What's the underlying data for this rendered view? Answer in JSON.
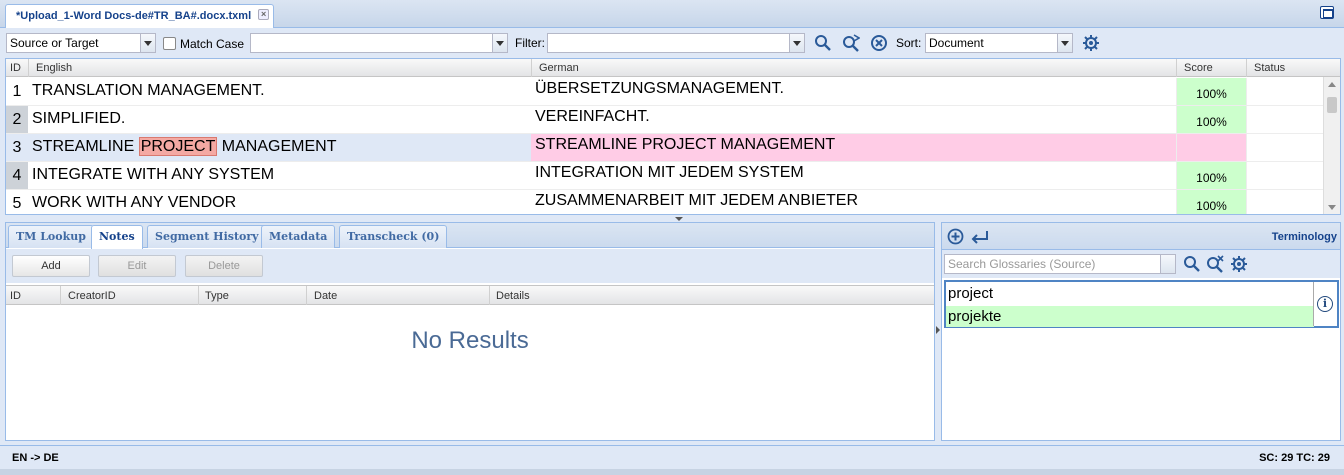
{
  "document_tab": {
    "title": "*Upload_1-Word Docs-de#TR_BA#.docx.txml",
    "close": "×"
  },
  "toolbar": {
    "scope_select": "Source or Target",
    "match_case_label": "Match Case",
    "search_value": "",
    "filter_label": "Filter:",
    "filter_value": "",
    "sort_label": "Sort:",
    "sort_value": "Document"
  },
  "grid": {
    "columns": {
      "id": "ID",
      "source": "English",
      "target": "German",
      "score": "Score",
      "status": "Status"
    },
    "rows": [
      {
        "id": "1",
        "source": "TRANSLATION MANAGEMENT.",
        "target": "ÜBERSETZUNGSMANAGEMENT.",
        "score": "100%",
        "status": ""
      },
      {
        "id": "2",
        "source": "SIMPLIFIED.",
        "target": "VEREINFACHT.",
        "score": "100%",
        "status": ""
      },
      {
        "id": "3",
        "source_pre": "STREAMLINE ",
        "source_hl": "PROJECT",
        "source_post": " MANAGEMENT",
        "target": "STREAMLINE PROJECT MANAGEMENT",
        "score": "",
        "status": ""
      },
      {
        "id": "4",
        "source": "INTEGRATE WITH ANY SYSTEM",
        "target": "INTEGRATION MIT JEDEM SYSTEM",
        "score": "100%",
        "status": ""
      },
      {
        "id": "5",
        "source": "WORK WITH ANY VENDOR",
        "target": "ZUSAMMENARBEIT MIT JEDEM ANBIETER",
        "score": "100%",
        "status": ""
      }
    ]
  },
  "bottom_tabs": [
    "TM Lookup",
    "Notes",
    "Segment History",
    "Metadata",
    "Transcheck (0)"
  ],
  "notes": {
    "buttons": {
      "add": "Add",
      "edit": "Edit",
      "delete": "Delete"
    },
    "columns": {
      "id": "ID",
      "creator": "CreatorID",
      "type": "Type",
      "date": "Date",
      "details": "Details"
    },
    "empty_text": "No Results"
  },
  "terminology": {
    "title": "Terminology",
    "search_placeholder": "Search Glossaries (Source)",
    "source_term": "project",
    "target_term": "projekte",
    "info_glyph": "i"
  },
  "status_bar": {
    "language_pair": "EN -> DE",
    "counts": "SC: 29 TC: 29"
  },
  "colors": {
    "accent": "#15428b",
    "match_green": "#ccffcc",
    "pending_pink": "#ffcce6",
    "highlight": "#f4a9a3"
  },
  "icons": [
    "search-icon",
    "search-next-icon",
    "clear-filter-icon",
    "settings-gear-icon",
    "add-circle-icon",
    "enter-icon",
    "info-icon"
  ]
}
